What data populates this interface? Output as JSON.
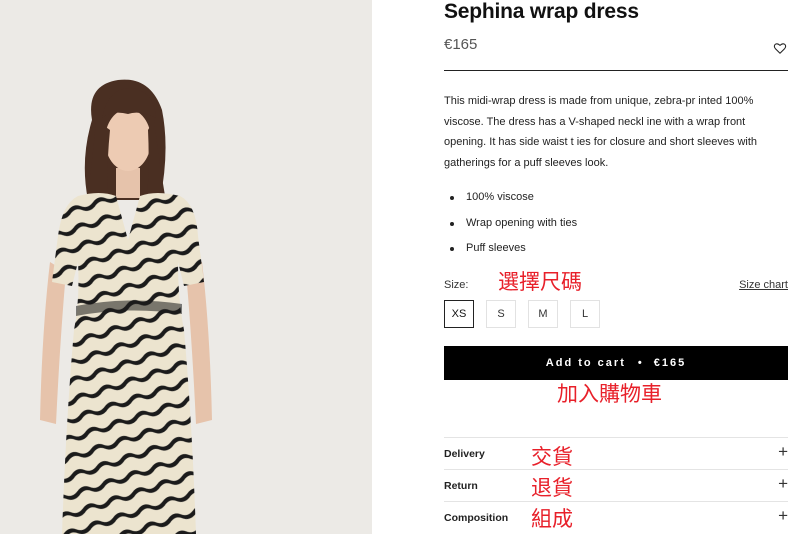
{
  "product": {
    "title": "Sephina wrap dress",
    "price": "€165",
    "wishlist_icon": "heart-icon"
  },
  "description": "This midi-wrap dress is made from unique, zebra-pr inted 100% viscose. The dress has a V-shaped neckl ine with a wrap front opening. It has side waist t ies for closure and short sleeves with gatherings for a puff sleeves look.",
  "features": [
    "100% viscose",
    "Wrap opening with ties",
    "Puff sleeves"
  ],
  "size": {
    "label": "Size:",
    "chart_link": "Size chart",
    "options": [
      "XS",
      "S",
      "M",
      "L"
    ],
    "selected": "XS"
  },
  "cart": {
    "label": "Add to cart",
    "separator": "•",
    "price": "€165"
  },
  "accordion": [
    {
      "label": "Delivery",
      "icon": "plus-icon"
    },
    {
      "label": "Return",
      "icon": "plus-icon"
    },
    {
      "label": "Composition",
      "icon": "plus-icon"
    }
  ],
  "annotations": {
    "size": "選擇尺碼",
    "cart": "加入購物車",
    "delivery": "交貨",
    "return": "退貨",
    "composition": "組成",
    "color": "#e8202a"
  }
}
